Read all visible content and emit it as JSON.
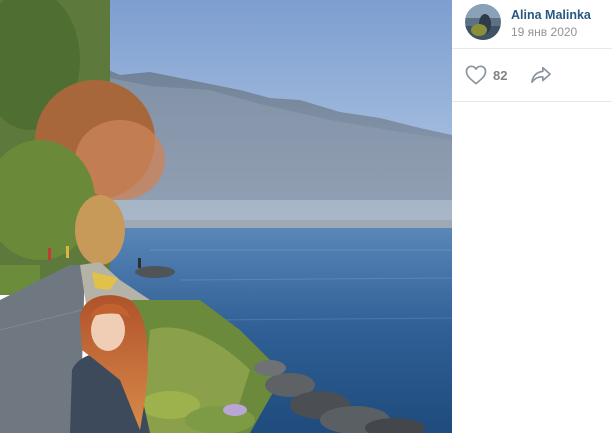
{
  "post": {
    "author": "Alina Malinka",
    "date": "19 янв 2020",
    "likes": "82"
  },
  "icons": {
    "like": "heart-outline-icon",
    "share": "share-arrow-icon"
  },
  "colors": {
    "author_link": "#2a5885",
    "muted": "#939393",
    "icon_gray": "#8a929b"
  }
}
